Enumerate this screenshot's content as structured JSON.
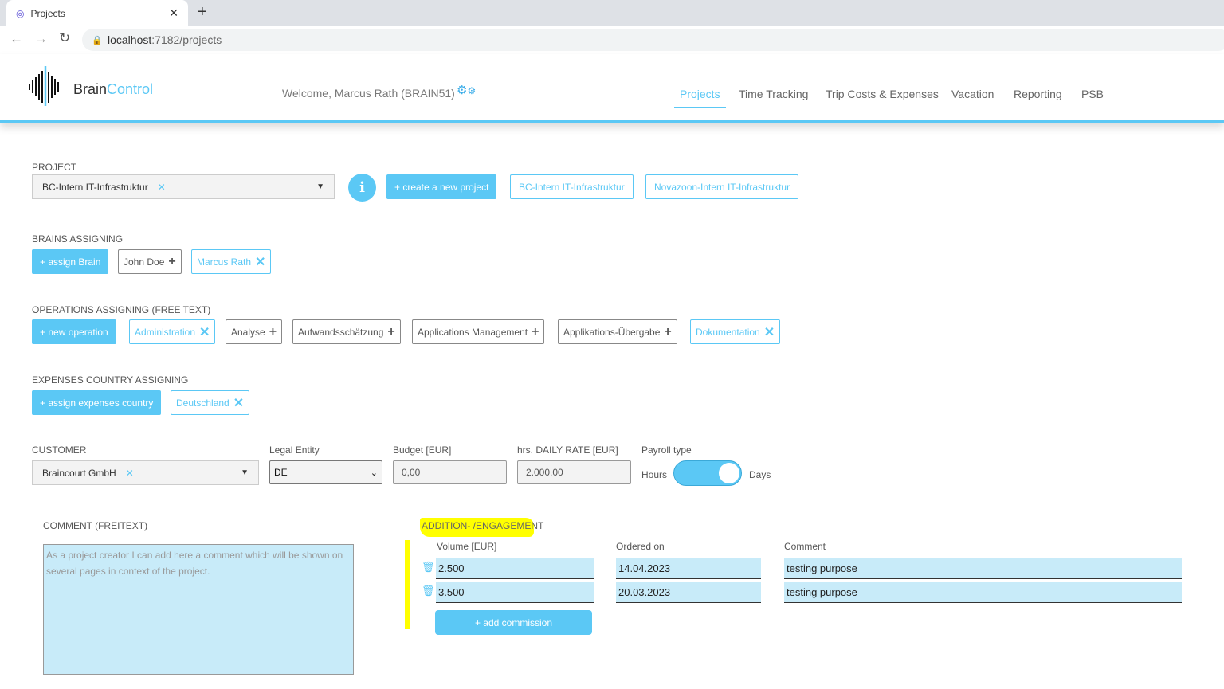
{
  "browser": {
    "tab_title": "Projects",
    "url_host": "localhost",
    "url_rest": ":7182/projects"
  },
  "header": {
    "brand_a": "Brain",
    "brand_b": "Control",
    "welcome": "Welcome, Marcus Rath (BRAIN51)",
    "nav": [
      "Projects",
      "Time Tracking",
      "Trip Costs & Expenses",
      "Vacation",
      "Reporting",
      "PSB"
    ]
  },
  "project": {
    "label": "PROJECT",
    "selected": "BC-Intern IT-Infrastruktur",
    "create": "+ create a new project",
    "quick": [
      "BC-Intern IT-Infrastruktur",
      "Novazoon-Intern IT-Infrastruktur"
    ]
  },
  "brains": {
    "label": "BRAINS ASSIGNING",
    "button": "+ assign Brain",
    "items": [
      {
        "name": "John Doe",
        "assigned": false
      },
      {
        "name": "Marcus Rath",
        "assigned": true
      }
    ]
  },
  "operations": {
    "label": "OPERATIONS ASSIGNING (FREE TEXT)",
    "button": "+ new operation",
    "items": [
      {
        "name": "Administration",
        "assigned": true
      },
      {
        "name": "Analyse",
        "assigned": false
      },
      {
        "name": "Aufwandsschätzung",
        "assigned": false
      },
      {
        "name": "Applications Management",
        "assigned": false
      },
      {
        "name": "Applikations-Übergabe",
        "assigned": false
      },
      {
        "name": "Dokumentation",
        "assigned": true
      }
    ]
  },
  "expenses": {
    "label": "EXPENSES COUNTRY ASSIGNING",
    "button": "+ assign expenses country",
    "items": [
      {
        "name": "Deutschland",
        "assigned": true
      }
    ]
  },
  "customer": {
    "label": "CUSTOMER",
    "value": "Braincourt GmbH",
    "legal_label": "Legal Entity",
    "legal_value": "DE",
    "budget_label": "Budget [EUR]",
    "budget_value": "0,00",
    "rate_label": "hrs. DAILY RATE [EUR]",
    "rate_value": "2.000,00",
    "payroll_label": "Payroll type",
    "payroll_left": "Hours",
    "payroll_right": "Days"
  },
  "comment": {
    "label": "COMMENT (FREITEXT)",
    "text": "As a project creator I can add here a comment which will be shown on several pages in context of the project."
  },
  "addition": {
    "label": "ADDITION- /ENGAGEMENT",
    "col_volume": "Volume [EUR]",
    "col_ordered": "Ordered on",
    "col_comment": "Comment",
    "rows": [
      {
        "volume": "2.500",
        "ordered": "14.04.2023",
        "comment": "testing purpose"
      },
      {
        "volume": "3.500",
        "ordered": "20.03.2023",
        "comment": "testing purpose"
      }
    ],
    "add": "+ add commission"
  },
  "colors": {
    "accent": "#5bc8f5",
    "input": "#c8ebf9",
    "highlight": "#ffff00"
  }
}
